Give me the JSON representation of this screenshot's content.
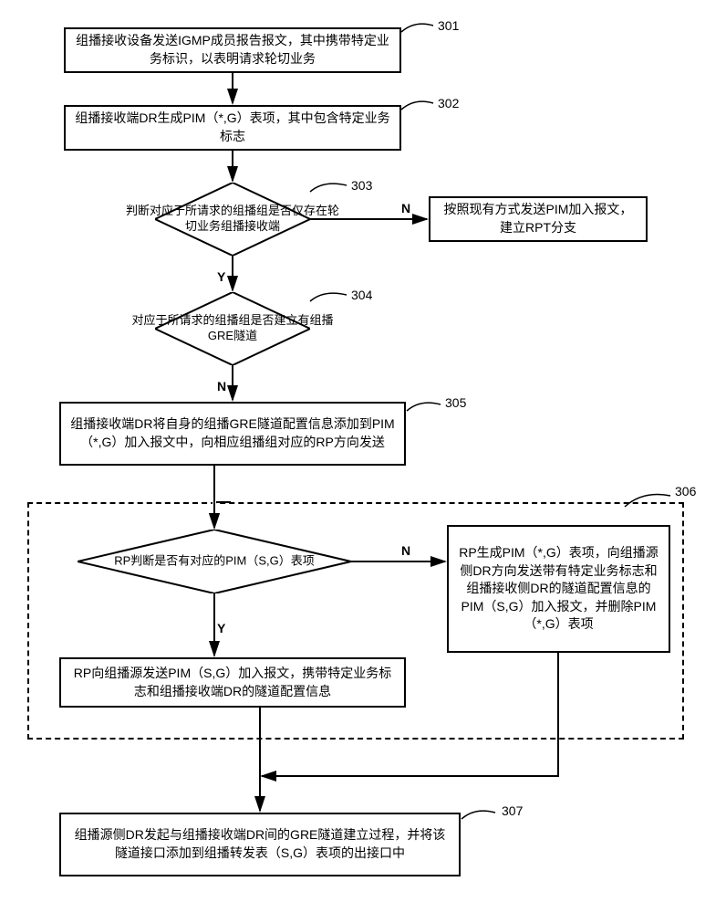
{
  "nodes": {
    "n301": {
      "num": "301",
      "text": "组播接收设备发送IGMP成员报告报文，其中携带特定业务标识，以表明请求轮切业务"
    },
    "n302": {
      "num": "302",
      "text": "组播接收端DR生成PIM（*,G）表项，其中包含特定业务标志"
    },
    "n303": {
      "num": "303",
      "text": "判断对应于所请求的组播组是否仅存在轮切业务组播接收端"
    },
    "n303no": {
      "text": "按照现有方式发送PIM加入报文，建立RPT分支"
    },
    "n304": {
      "num": "304",
      "text": "对应于所请求的组播组是否建立有组播GRE隧道"
    },
    "n305": {
      "num": "305",
      "text": "组播接收端DR将自身的组播GRE隧道配置信息添加到PIM（*,G）加入报文中，向相应组播组对应的RP方向发送"
    },
    "n306": {
      "num": "306"
    },
    "n306d": {
      "text": "RP判断是否有对应的PIM（S,G）表项"
    },
    "n306y": {
      "text": "RP向组播源发送PIM（S,G）加入报文，携带特定业务标志和组播接收端DR的隧道配置信息"
    },
    "n306n": {
      "text": "RP生成PIM（*,G）表项，向组播源侧DR方向发送带有特定业务标志和组播接收侧DR的隧道配置信息的PIM（S,G）加入报文，并删除PIM（*,G）表项"
    },
    "n307": {
      "num": "307",
      "text": "组播源侧DR发起与组播接收端DR间的GRE隧道建立过程，并将该隧道接口添加到组播转发表（S,G）表项的出接口中"
    }
  },
  "labels": {
    "yes": "Y",
    "no": "N"
  }
}
